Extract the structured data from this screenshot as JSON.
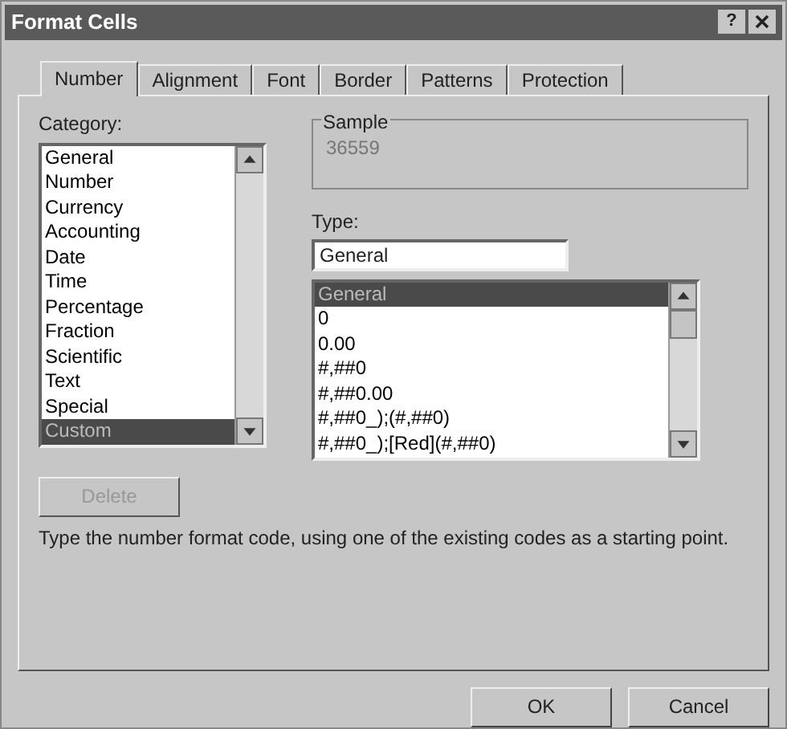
{
  "window": {
    "title": "Format Cells",
    "help_button": "?"
  },
  "tabs": [
    {
      "label": "Number",
      "selected": true
    },
    {
      "label": "Alignment",
      "selected": false
    },
    {
      "label": "Font",
      "selected": false
    },
    {
      "label": "Border",
      "selected": false
    },
    {
      "label": "Patterns",
      "selected": false
    },
    {
      "label": "Protection",
      "selected": false
    }
  ],
  "category": {
    "label": "Category:",
    "items": [
      {
        "label": "General",
        "selected": false
      },
      {
        "label": "Number",
        "selected": false
      },
      {
        "label": "Currency",
        "selected": false
      },
      {
        "label": "Accounting",
        "selected": false
      },
      {
        "label": "Date",
        "selected": false
      },
      {
        "label": "Time",
        "selected": false
      },
      {
        "label": "Percentage",
        "selected": false
      },
      {
        "label": "Fraction",
        "selected": false
      },
      {
        "label": "Scientific",
        "selected": false
      },
      {
        "label": "Text",
        "selected": false
      },
      {
        "label": "Special",
        "selected": false
      },
      {
        "label": "Custom",
        "selected": true
      }
    ]
  },
  "sample": {
    "label": "Sample",
    "value": "36559"
  },
  "type": {
    "label": "Type:",
    "value": "General",
    "items": [
      {
        "label": "General",
        "selected": true
      },
      {
        "label": "0",
        "selected": false
      },
      {
        "label": "0.00",
        "selected": false
      },
      {
        "label": "#,##0",
        "selected": false
      },
      {
        "label": "#,##0.00",
        "selected": false
      },
      {
        "label": "#,##0_);(#,##0)",
        "selected": false
      },
      {
        "label": "#,##0_);[Red](#,##0)",
        "selected": false
      }
    ]
  },
  "delete_button": {
    "label": "Delete",
    "disabled": true
  },
  "description": "Type the number format code, using one of the existing codes as a starting point.",
  "buttons": [
    "OK",
    "Cancel"
  ]
}
